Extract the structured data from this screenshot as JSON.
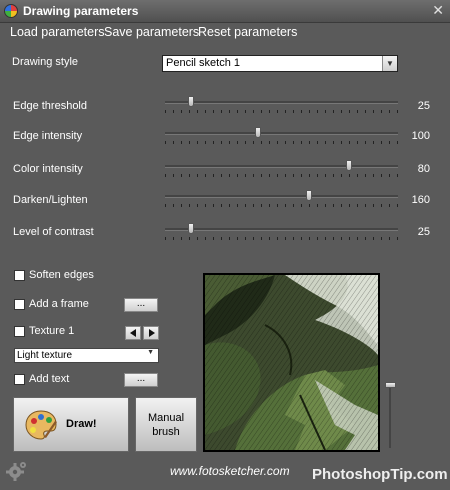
{
  "window": {
    "title": "Drawing parameters",
    "close_symbol": "✕"
  },
  "menu": {
    "items": [
      "Load parameters",
      "Save parameters",
      "Reset parameters"
    ]
  },
  "drawing_style": {
    "label": "Drawing style",
    "value": "Pencil sketch 1"
  },
  "sliders": [
    {
      "label": "Edge threshold",
      "value": "25",
      "level": 0.11
    },
    {
      "label": "Edge intensity",
      "value": "100",
      "level": 0.4
    },
    {
      "label": "Color intensity",
      "value": "80",
      "level": 0.79
    },
    {
      "label": "Darken/Lighten",
      "value": "160",
      "level": 0.62
    },
    {
      "label": "Level of contrast",
      "value": "25",
      "level": 0.11
    }
  ],
  "options": {
    "soften_edges": {
      "label": "Soften edges",
      "checked": false
    },
    "add_frame": {
      "label": "Add a frame",
      "checked": false,
      "button": "..."
    },
    "texture": {
      "label": "Texture 1",
      "checked": false,
      "select_value": "Light texture"
    },
    "add_text": {
      "label": "Add text",
      "checked": false,
      "button": "..."
    }
  },
  "buttons": {
    "draw": "Draw!",
    "manual_line1": "Manual",
    "manual_line2": "brush"
  },
  "preview": {
    "zoom_level": 0.0
  },
  "footer": {
    "website": "www.fotosketcher.com",
    "watermark": "PhotoshopTip.com"
  },
  "icons": {
    "app": "fotosketcher-app-icon",
    "close": "close-icon",
    "dropdown": "chevron-down-icon",
    "palette": "palette-icon",
    "gear": "gear-icon"
  },
  "colors": {
    "window_bg": "#5a5a5a",
    "text": "#ffffff"
  }
}
